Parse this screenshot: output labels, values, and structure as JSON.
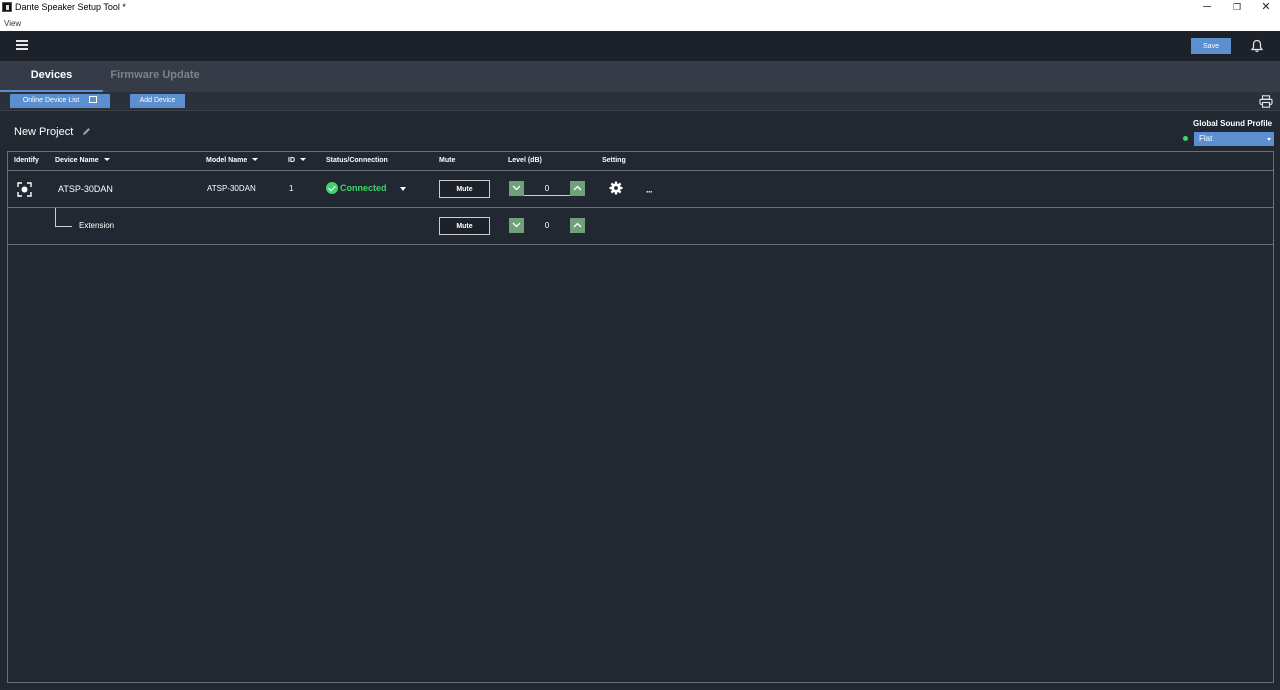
{
  "window": {
    "title": "Dante Speaker Setup Tool *",
    "min": "─",
    "max": "❐",
    "close": "✕"
  },
  "menu": {
    "view": "View"
  },
  "appbar": {
    "save_label": "Save"
  },
  "tabs": [
    {
      "label": "Devices",
      "active": true
    },
    {
      "label": "Firmware Update",
      "active": false
    }
  ],
  "toolbar": {
    "online_device_list": "Online Device List",
    "add_device": "Add Device"
  },
  "project": {
    "title": "New Project"
  },
  "global_sound_profile": {
    "label": "Global Sound Profile",
    "value": "Flat"
  },
  "table": {
    "headers": {
      "identify": "Identify",
      "device_name": "Device Name",
      "model_name": "Model Name",
      "id": "ID",
      "status": "Status/Connection",
      "mute": "Mute",
      "level": "Level (dB)",
      "setting": "Setting"
    },
    "rows": [
      {
        "device_name": "ATSP-30DAN",
        "model_name": "ATSP-30DAN",
        "id": "1",
        "status": "Connected",
        "mute_label": "Mute",
        "level": "0",
        "more": "···"
      },
      {
        "device_name": "Extension",
        "mute_label": "Mute",
        "level": "0"
      }
    ]
  },
  "colors": {
    "accent": "#5b8fd0",
    "status_ok": "#3fd46b",
    "level_btn": "#6fa07a",
    "background": "#222831"
  }
}
